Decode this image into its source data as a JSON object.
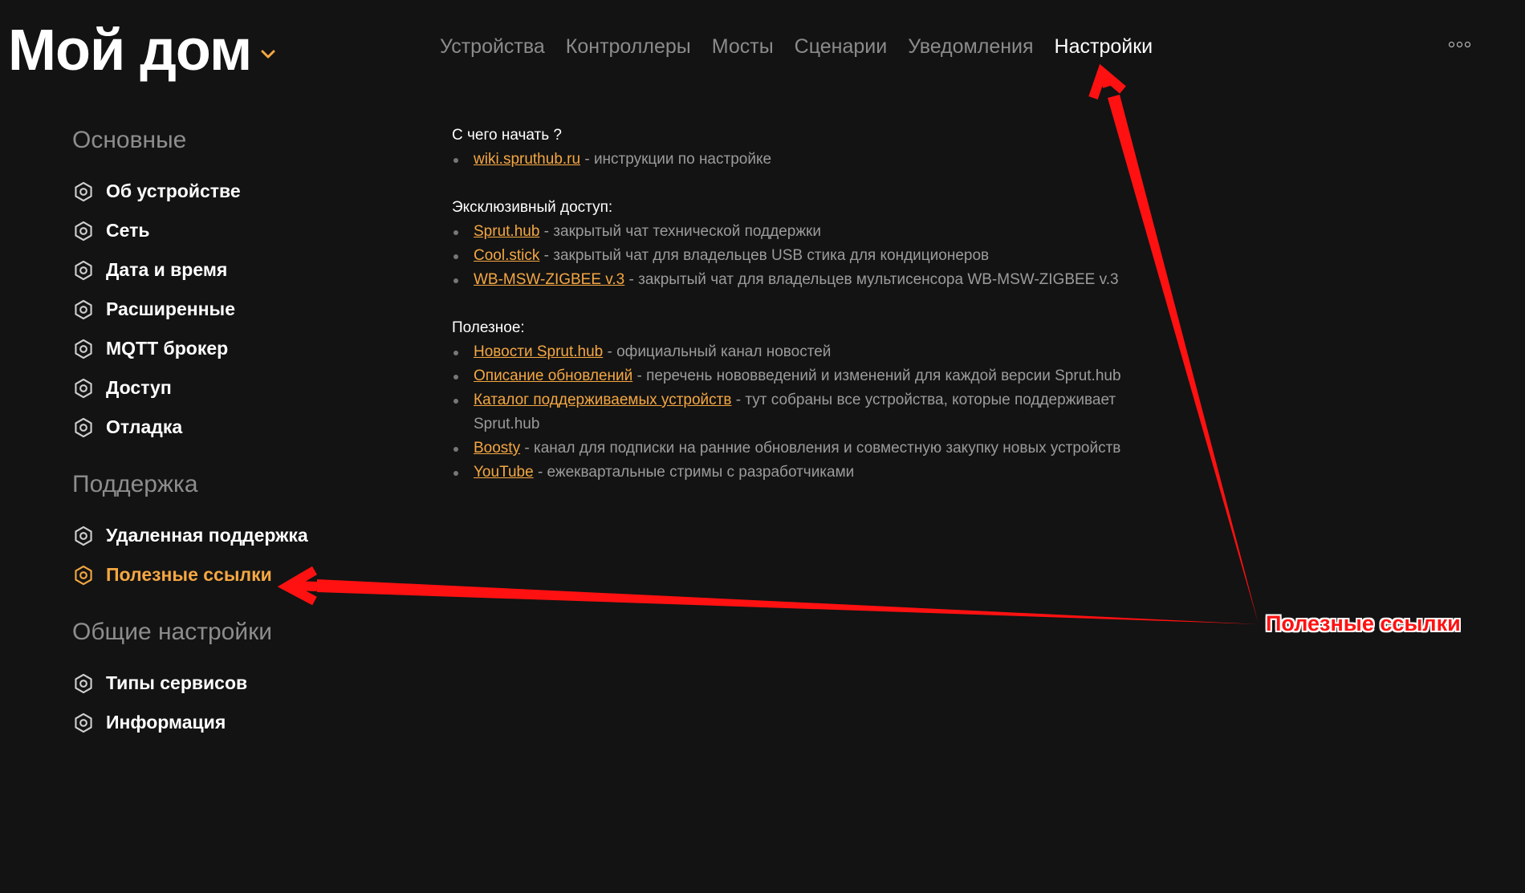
{
  "header": {
    "title": "Мой дом",
    "nav": [
      "Устройства",
      "Контроллеры",
      "Мосты",
      "Сценарии",
      "Уведомления",
      "Настройки"
    ],
    "active_nav": "Настройки"
  },
  "sidebar": {
    "sections": [
      {
        "title": "Основные",
        "items": [
          "Об устройстве",
          "Сеть",
          "Дата и время",
          "Расширенные",
          "MQTT брокер",
          "Доступ",
          "Отладка"
        ]
      },
      {
        "title": "Поддержка",
        "items": [
          "Удаленная поддержка",
          "Полезные ссылки"
        ]
      },
      {
        "title": "Общие настройки",
        "items": [
          "Типы сервисов",
          "Информация"
        ]
      }
    ],
    "active_item": "Полезные ссылки"
  },
  "content": {
    "groups": [
      {
        "heading": "С чего начать ?",
        "links": [
          {
            "link": "wiki.spruthub.ru",
            "text": " - инструкции по настройке"
          }
        ]
      },
      {
        "heading": "Эксклюзивный доступ:",
        "links": [
          {
            "link": "Sprut.hub",
            "text": " - закрытый чат технической поддержки"
          },
          {
            "link": "Cool.stick",
            "text": " - закрытый чат для владельцев USB стика для кондиционеров"
          },
          {
            "link": "WB-MSW-ZIGBEE v.3",
            "text": " - закрытый чат для владельцев мультисенсора WB-MSW-ZIGBEE v.3"
          }
        ]
      },
      {
        "heading": "Полезное:",
        "links": [
          {
            "link": "Новости Sprut.hub",
            "text": " - официальный канал новостей"
          },
          {
            "link": "Описание обновлений",
            "text": " - перечень нововведений и изменений для каждой версии Sprut.hub"
          },
          {
            "link": "Каталог поддерживаемых устройств",
            "text": " - тут собраны все устройства, которые поддерживает Sprut.hub"
          },
          {
            "link": "Boosty",
            "text": " - канал для подписки на ранние обновления и совместную закупку новых устройств"
          },
          {
            "link": "YouTube",
            "text": " - ежеквартальные стримы с разработчиками"
          }
        ]
      }
    ]
  },
  "annotation": {
    "label": "Полезные ссылки",
    "color": "#ff1111"
  },
  "colors": {
    "background": "#131313",
    "accent": "#f5a742",
    "muted": "#8b8b8b"
  },
  "icons": {
    "sidebar": "gear-icon",
    "title": "chevron-down-icon",
    "menu": "more-icon"
  }
}
